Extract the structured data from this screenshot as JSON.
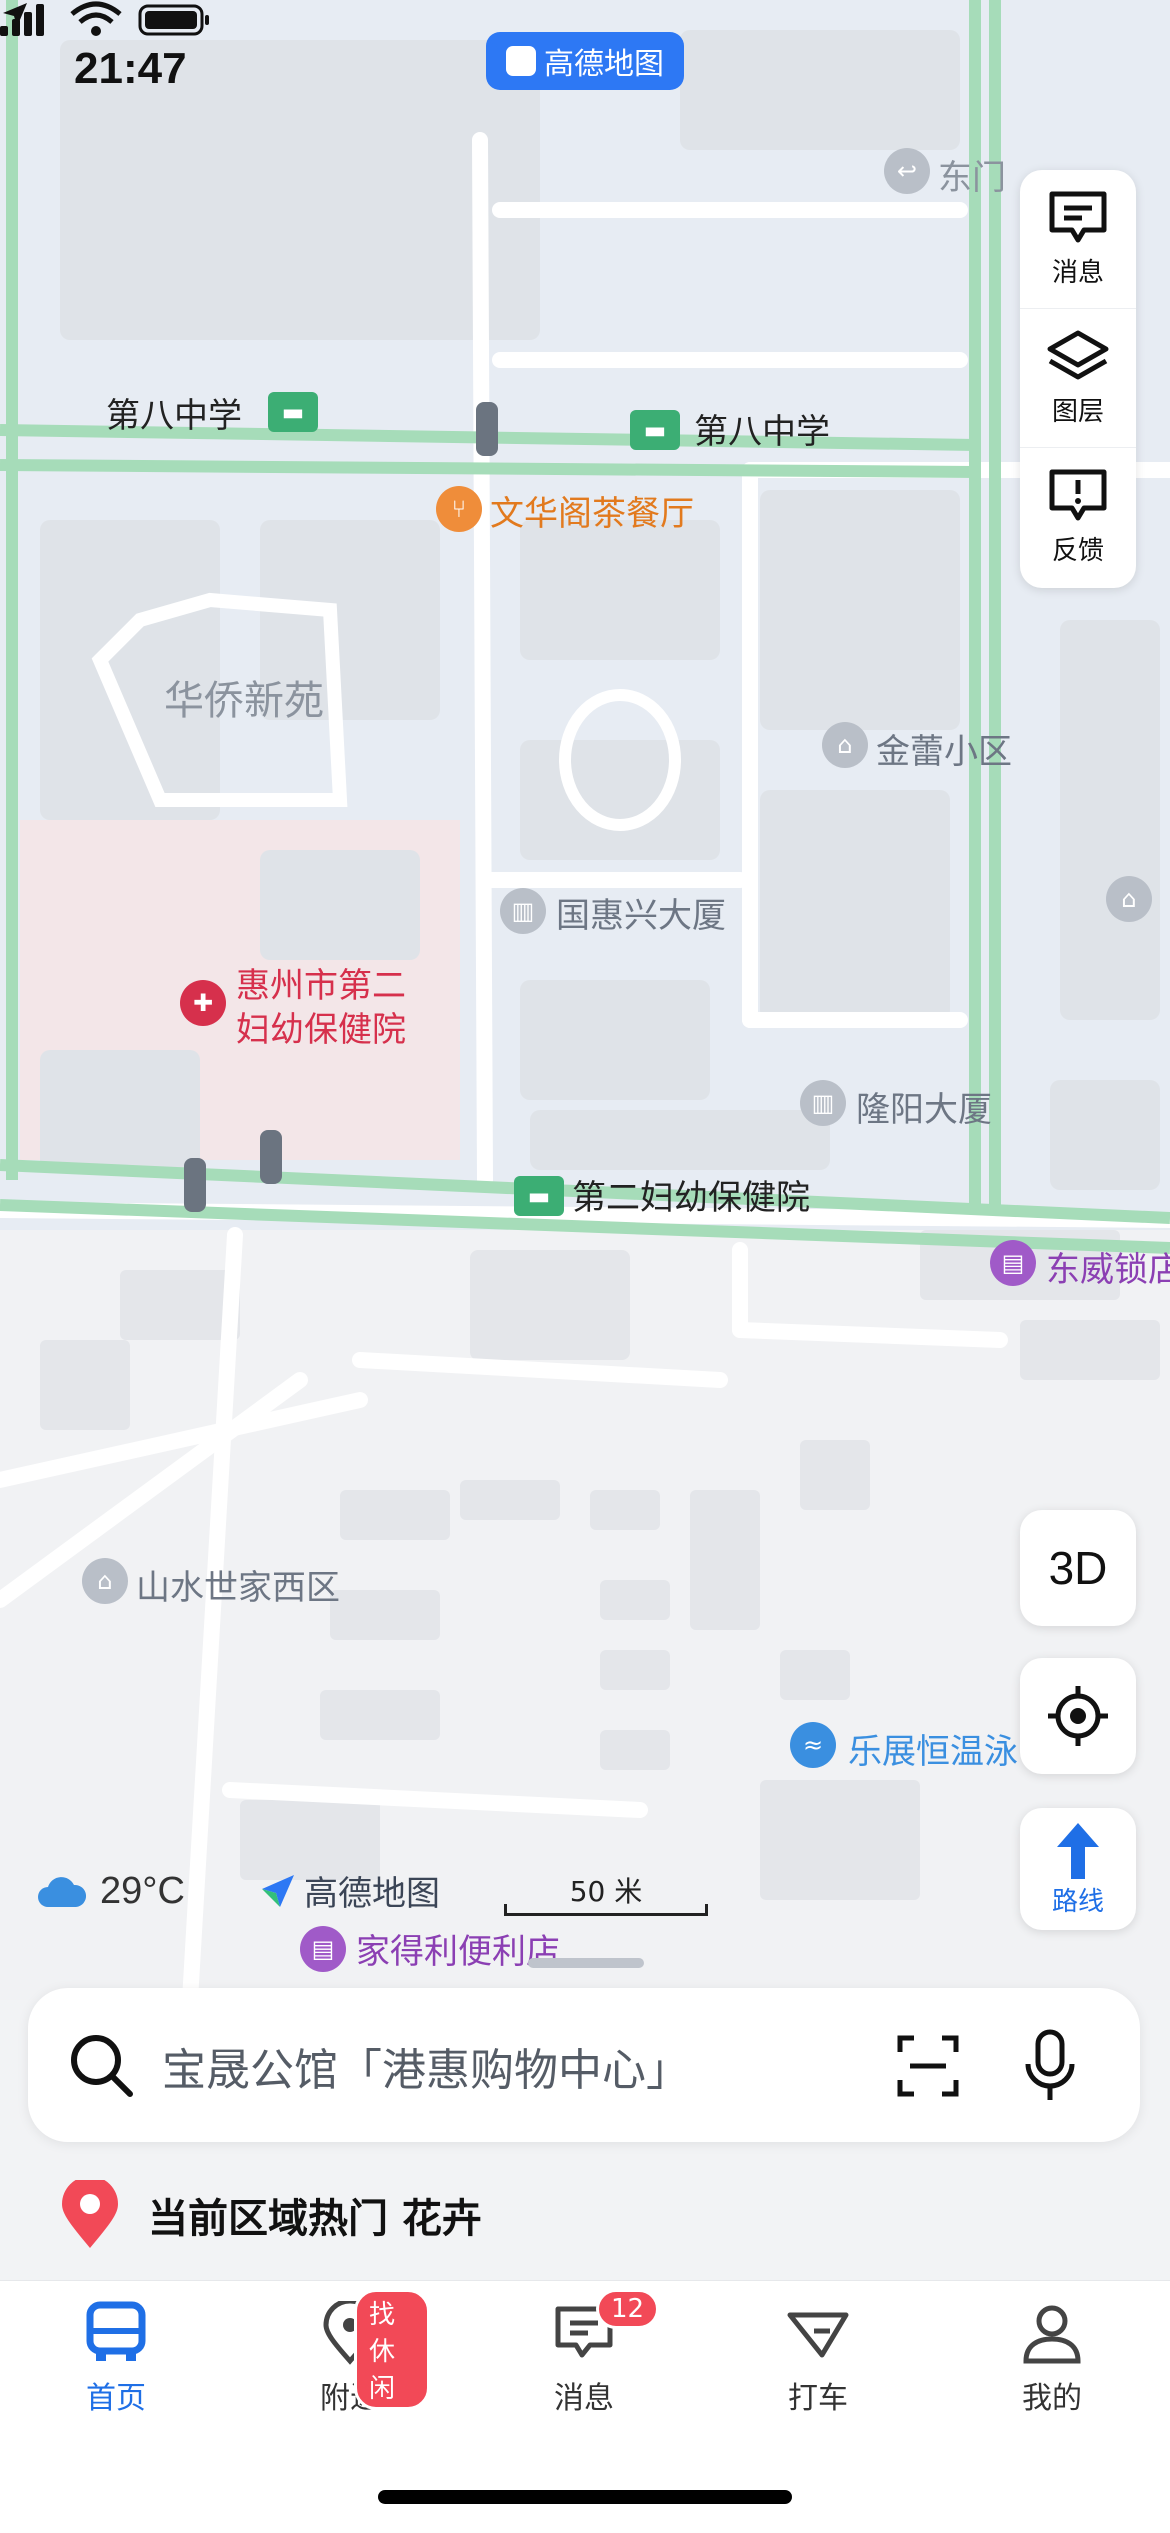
{
  "status_bar": {
    "time": "21:47",
    "app_name": "高德地图"
  },
  "map": {
    "labels": {
      "east_gate": "东门",
      "school_left": "第八中学",
      "school_right": "第八中学",
      "restaurant": "文华阁茶餐厅",
      "community1": "华侨新苑",
      "community2": "金蕾小区",
      "building1": "国惠兴大厦",
      "hospital_line1": "惠州市第二",
      "hospital_line2": "妇幼保健院",
      "building2": "隆阳大厦",
      "bus_stop": "第二妇幼保健院",
      "lock_shop": "东威锁店",
      "community3": "山水世家西区",
      "hot_spring": "乐展恒温泳",
      "store": "家得利便利店"
    }
  },
  "side_panel": {
    "messages": "消息",
    "layers": "图层",
    "feedback": "反馈"
  },
  "controls": {
    "view_3d": "3D",
    "route": "路线"
  },
  "weather": {
    "temperature": "29°C"
  },
  "brand_watermark": "高德地图",
  "scale_bar": "50 米",
  "search": {
    "placeholder": "宝晟公馆「港惠购物中心」"
  },
  "hot_area": "当前区域热门 花卉",
  "tabs": [
    {
      "label": "首页",
      "active": true
    },
    {
      "label": "附近",
      "badge": "找休闲"
    },
    {
      "label": "消息",
      "badge": "12"
    },
    {
      "label": "打车"
    },
    {
      "label": "我的"
    }
  ],
  "colors": {
    "accent": "#1f6fe6",
    "badge": "#f24957",
    "road_green": "#9fd9b4"
  }
}
